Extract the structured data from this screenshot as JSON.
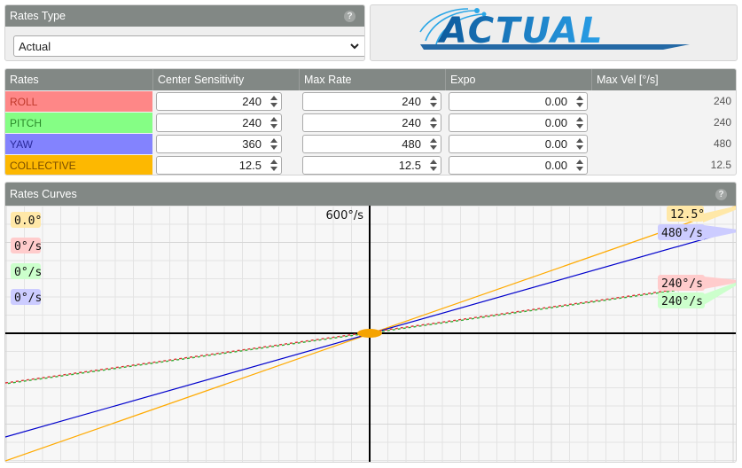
{
  "rates_type": {
    "title": "Rates Type",
    "help": "?",
    "selected": "Actual"
  },
  "logo": {
    "text": "ACTUAL"
  },
  "rates_table": {
    "headers": [
      "Rates",
      "Center Sensitivity",
      "Max Rate",
      "Expo",
      "Max Vel [°/s]"
    ],
    "rows": [
      {
        "axis": "ROLL",
        "color": "#fe8787",
        "center": "240",
        "max_rate": "240",
        "expo": "0.00",
        "max_vel": "240"
      },
      {
        "axis": "PITCH",
        "color": "#85fe85",
        "center": "240",
        "max_rate": "240",
        "expo": "0.00",
        "max_vel": "240"
      },
      {
        "axis": "YAW",
        "color": "#8383fe",
        "center": "360",
        "max_rate": "480",
        "expo": "0.00",
        "max_vel": "480"
      },
      {
        "axis": "COLLECTIVE",
        "color": "#fdb801",
        "center": "12.5",
        "max_rate": "12.5",
        "expo": "0.00",
        "max_vel": "12.5"
      }
    ]
  },
  "rates_curves": {
    "title": "Rates Curves",
    "help": "?",
    "top_scale_label": "600°/s",
    "live_labels": [
      "0.0°",
      "0°/s",
      "0°/s",
      "0°/s"
    ],
    "end_labels": {
      "collective": "12.5°",
      "yaw": "480°/s",
      "roll": "240°/s",
      "pitch": "240°/s"
    },
    "colors": {
      "roll_line": "#d33",
      "pitch_line": "#3a3",
      "yaw_line": "#0000cc",
      "collective_line": "#ffaa00"
    }
  }
}
